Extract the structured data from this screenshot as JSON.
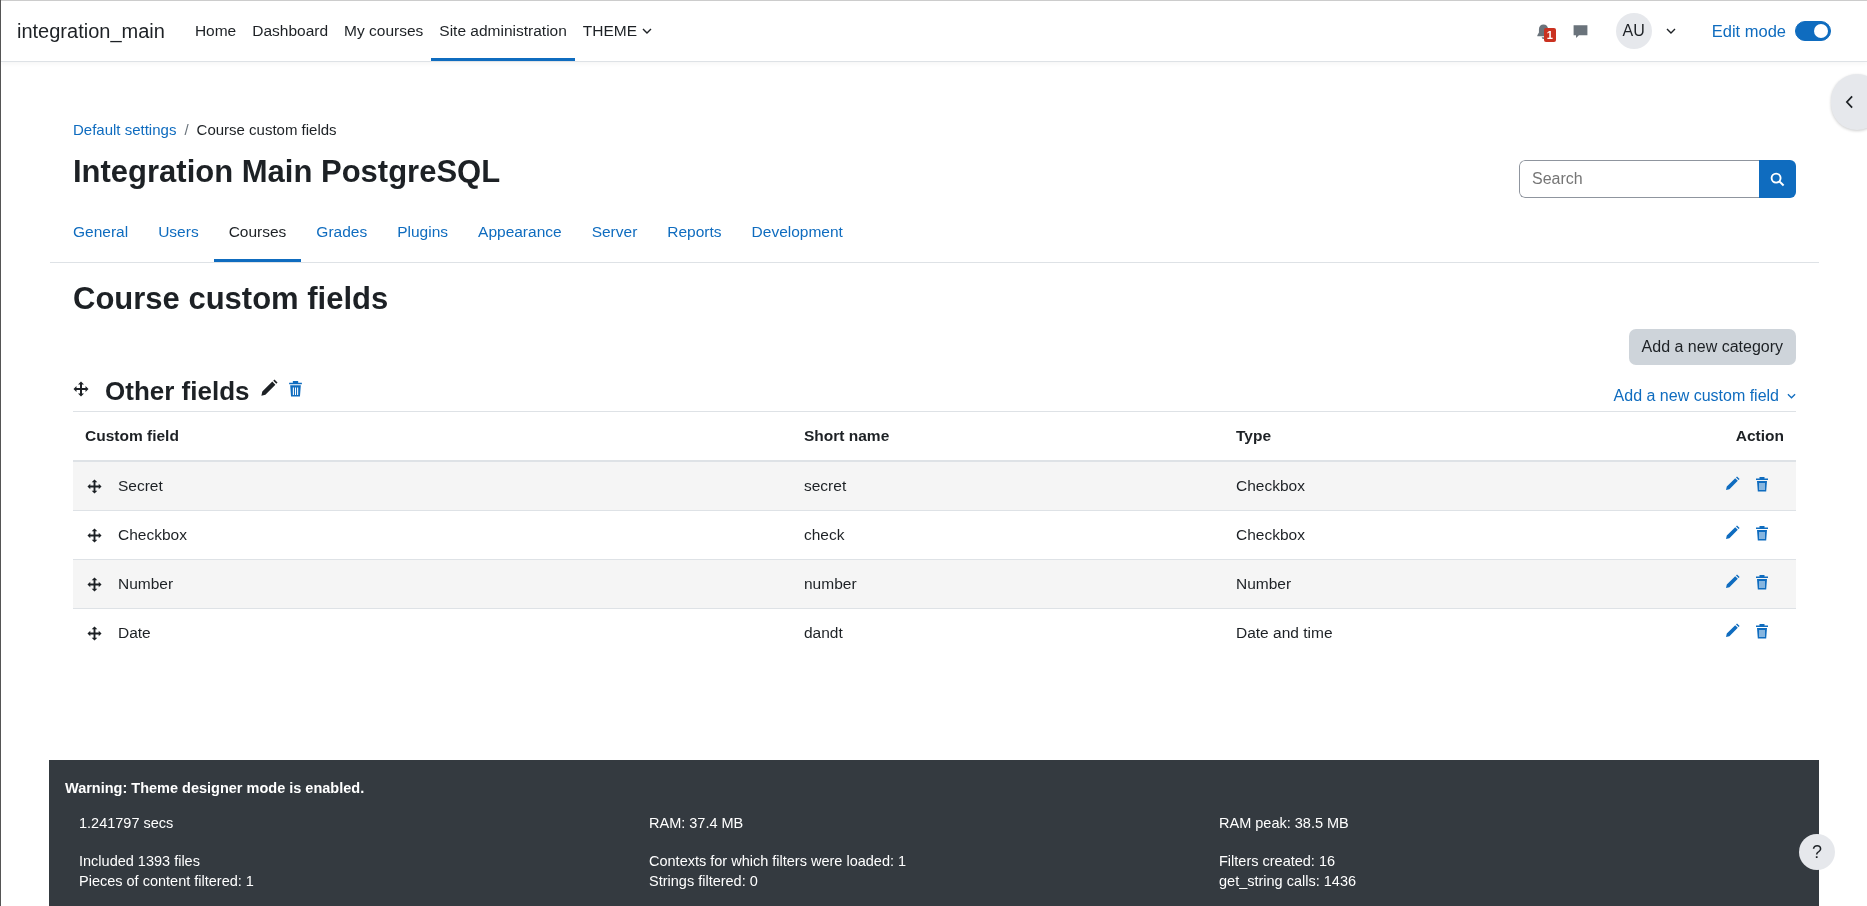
{
  "navbar": {
    "site_name": "integration_main",
    "items": [
      {
        "label": "Home",
        "selected": false,
        "dropdown": false
      },
      {
        "label": "Dashboard",
        "selected": false,
        "dropdown": false
      },
      {
        "label": "My courses",
        "selected": false,
        "dropdown": false
      },
      {
        "label": "Site administration",
        "selected": true,
        "dropdown": false
      },
      {
        "label": "THEME",
        "selected": false,
        "dropdown": true
      }
    ],
    "notification_count": "1",
    "avatar_initials": "AU",
    "edit_mode": {
      "label": "Edit mode",
      "on": true
    }
  },
  "breadcrumb": {
    "items": [
      {
        "label": "Default settings",
        "link": true
      },
      {
        "label": "Course custom fields",
        "link": false
      }
    ],
    "separator": "/"
  },
  "page_title": "Integration Main PostgreSQL",
  "search": {
    "placeholder": "Search"
  },
  "tabs": [
    {
      "label": "General",
      "selected": false
    },
    {
      "label": "Users",
      "selected": false
    },
    {
      "label": "Courses",
      "selected": true
    },
    {
      "label": "Grades",
      "selected": false
    },
    {
      "label": "Plugins",
      "selected": false
    },
    {
      "label": "Appearance",
      "selected": false
    },
    {
      "label": "Server",
      "selected": false
    },
    {
      "label": "Reports",
      "selected": false
    },
    {
      "label": "Development",
      "selected": false
    }
  ],
  "heading": "Course custom fields",
  "add_category_button": "Add a new category",
  "category": {
    "name": "Other fields",
    "add_field_menu": "Add a new custom field",
    "table": {
      "columns": [
        "Custom field",
        "Short name",
        "Type",
        "Action"
      ],
      "rows": [
        {
          "name": "Secret",
          "shortname": "secret",
          "type": "Checkbox"
        },
        {
          "name": "Checkbox",
          "shortname": "check",
          "type": "Checkbox"
        },
        {
          "name": "Number",
          "shortname": "number",
          "type": "Number"
        },
        {
          "name": "Date",
          "shortname": "dandt",
          "type": "Date and time"
        }
      ]
    }
  },
  "footer": {
    "warning": "Warning: Theme designer mode is enabled.",
    "stats": [
      "1.241797 secs",
      "RAM: 37.4 MB",
      "RAM peak: 38.5 MB",
      "Included 1393 files",
      "Contexts for which filters were loaded: 1",
      "Filters created: 16",
      "Pieces of content filtered: 1",
      "Strings filtered: 0",
      "get_string calls: 1436"
    ]
  },
  "help_button": "?"
}
